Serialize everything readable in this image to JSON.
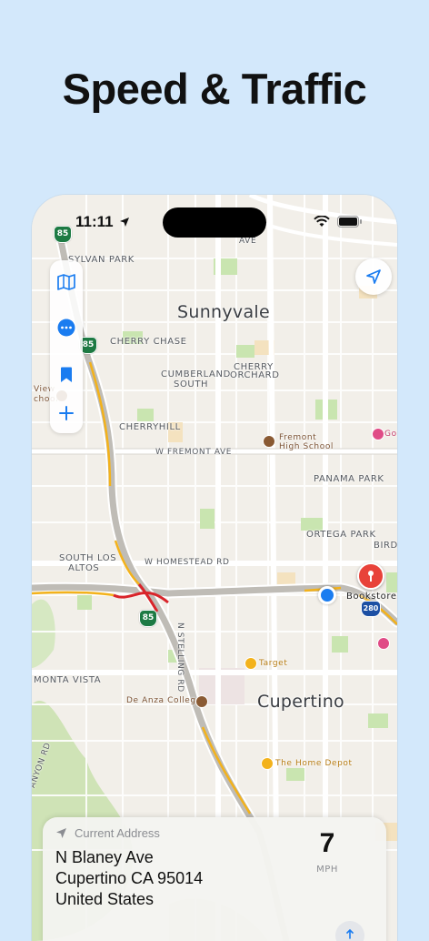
{
  "headline": "Speed & Traffic",
  "status_bar": {
    "time": "11:11"
  },
  "map": {
    "labels": {
      "sunnyvale": "Sunnyvale",
      "cupertino": "Cupertino",
      "sylvan_park": "SYLVAN PARK",
      "cherry_chase": "CHERRY CHASE",
      "cumberland_south_1": "CUMBERLAND",
      "cumberland_south_2": "SOUTH",
      "cherry_orchard_1": "CHERRY",
      "cherry_orchard_2": "ORCHARD",
      "cherryhill": "CHERRYHILL",
      "fremont_ave": "W FREMONT AVE",
      "panama_park": "PANAMA PARK",
      "ortega_park": "ORTEGA PARK",
      "birdl": "BIRDL",
      "south_los_altos_1": "SOUTH LOS",
      "south_los_altos_2": "ALTOS",
      "homestead_rd": "W HOMESTEAD RD",
      "n_stelling_rd": "N STELLING RD",
      "monta_vista": "MONTA VISTA",
      "anyon_rd": "ANYON RD",
      "ave": "AVE",
      "view_school_1": "View",
      "view_school_2": "chool",
      "fremont_high_1": "Fremont",
      "fremont_high_2": "High School",
      "bookstore": "Bookstore",
      "target": "Target",
      "de_anza": "De Anza College",
      "home_depot": "The Home Depot",
      "go": "Go"
    },
    "shields": {
      "sr85_top": "85",
      "sr85_mid": "85",
      "sr85_bottom": "85",
      "i280": "280"
    }
  },
  "current_address": {
    "header": "Current Address",
    "line1": "N Blaney Ave",
    "line2": "Cupertino CA 95014",
    "line3": "United States"
  },
  "speed": {
    "value": "7",
    "unit": "MPH"
  },
  "colors": {
    "background": "#d3e8fb",
    "accent": "#1a7cf0",
    "pin": "#e8423a",
    "highway_shield": "#1d7a43",
    "traffic_heavy": "#d9242a",
    "traffic_moderate": "#f3b21b"
  },
  "icons": {
    "map_mode": "map-icon",
    "more": "ellipsis-circle-icon",
    "bookmark": "bookmark-icon",
    "add": "plus-icon",
    "locate": "location-arrow-icon",
    "share": "share-icon"
  }
}
